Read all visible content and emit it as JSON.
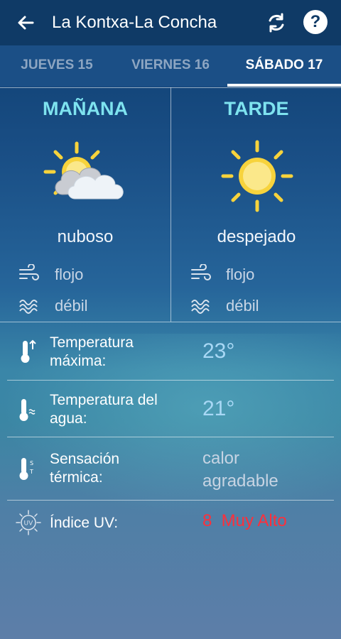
{
  "header": {
    "title": "La Kontxa-La Concha",
    "back_icon": "arrow-left-icon",
    "refresh_icon": "refresh-icon",
    "help_label": "?"
  },
  "tabs": [
    {
      "label": "JUEVES 15",
      "selected": false
    },
    {
      "label": "VIERNES 16",
      "selected": false
    },
    {
      "label": "SÁBADO 17",
      "selected": true
    }
  ],
  "forecast": {
    "morning": {
      "period": "MAÑANA",
      "condition": "nuboso",
      "icon": "partly-cloudy-icon",
      "wind": "flojo",
      "waves": "débil"
    },
    "afternoon": {
      "period": "TARDE",
      "condition": "despejado",
      "icon": "sun-icon",
      "wind": "flojo",
      "waves": "débil"
    }
  },
  "details": {
    "max_temp": {
      "label_line1": "Temperatura",
      "label_line2": "máxima:",
      "value": "23°"
    },
    "water_temp": {
      "label_line1": "Temperatura del",
      "label_line2": "agua:",
      "value": "21°"
    },
    "feels_like": {
      "label_line1": "Sensación",
      "label_line2": "térmica:",
      "value_line1": "calor",
      "value_line2": "agradable"
    },
    "uv": {
      "label": "Índice UV:",
      "value": "8  Muy Alto",
      "color": "#ff2f3a"
    }
  },
  "colors": {
    "header_bg": "#0f3a66",
    "tabs_bg": "#1b4f86",
    "accent_cyan": "#7ee3ef",
    "sun_yellow": "#f7d33c"
  }
}
